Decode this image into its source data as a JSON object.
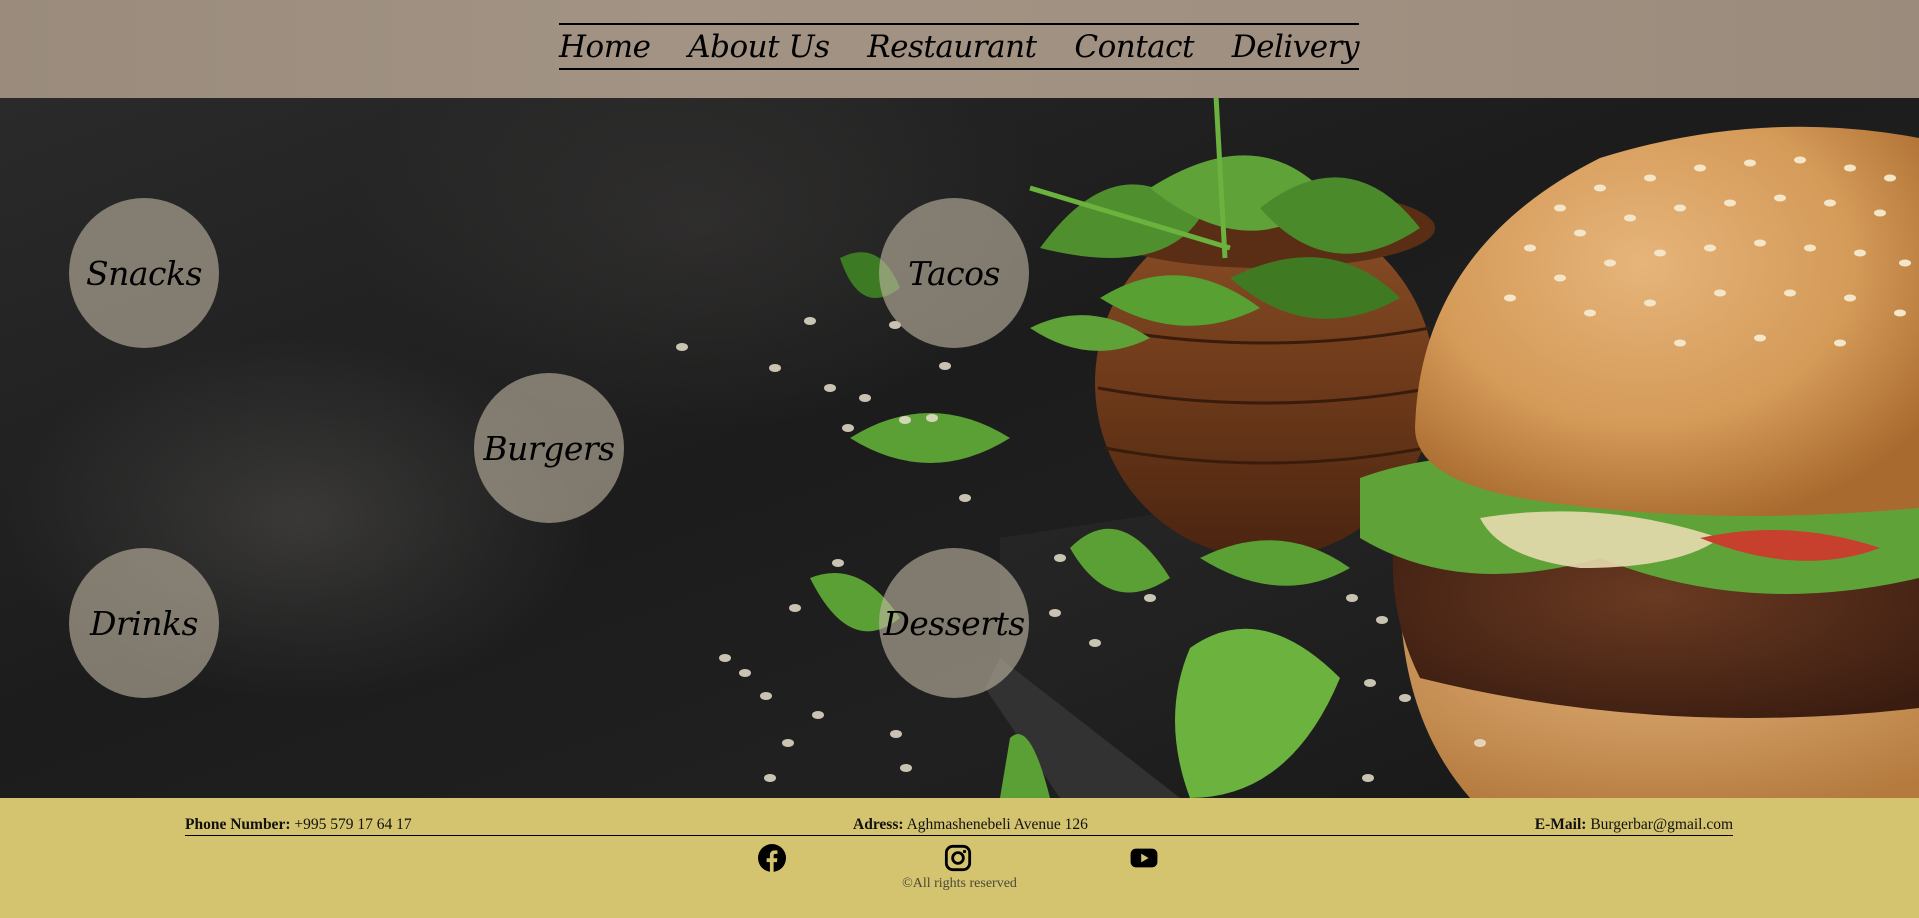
{
  "nav": {
    "items": [
      {
        "label": "Home"
      },
      {
        "label": "About Us"
      },
      {
        "label": "Restaurant"
      },
      {
        "label": "Contact"
      },
      {
        "label": "Delivery"
      }
    ]
  },
  "categories": {
    "snacks": "Snacks",
    "tacos": "Tacos",
    "burgers": "Burgers",
    "drinks": "Drinks",
    "desserts": "Desserts"
  },
  "footer": {
    "phone_label": "Phone Number:",
    "phone_value": "+995 579 17 64 17",
    "address_label": "Adress:",
    "address_value": "Aghmashenebeli Avenue 126",
    "email_label": "E-Mail:",
    "email_value": "Burgerbar@gmail.com",
    "social": [
      {
        "icon": "facebook-icon"
      },
      {
        "icon": "instagram-icon"
      },
      {
        "icon": "youtube-icon"
      }
    ],
    "copyright": "©All rights reserved"
  },
  "colors": {
    "header_bg": "#a09081",
    "footer_bg": "#d4c36f",
    "circle_bg": "#beb4a2"
  }
}
